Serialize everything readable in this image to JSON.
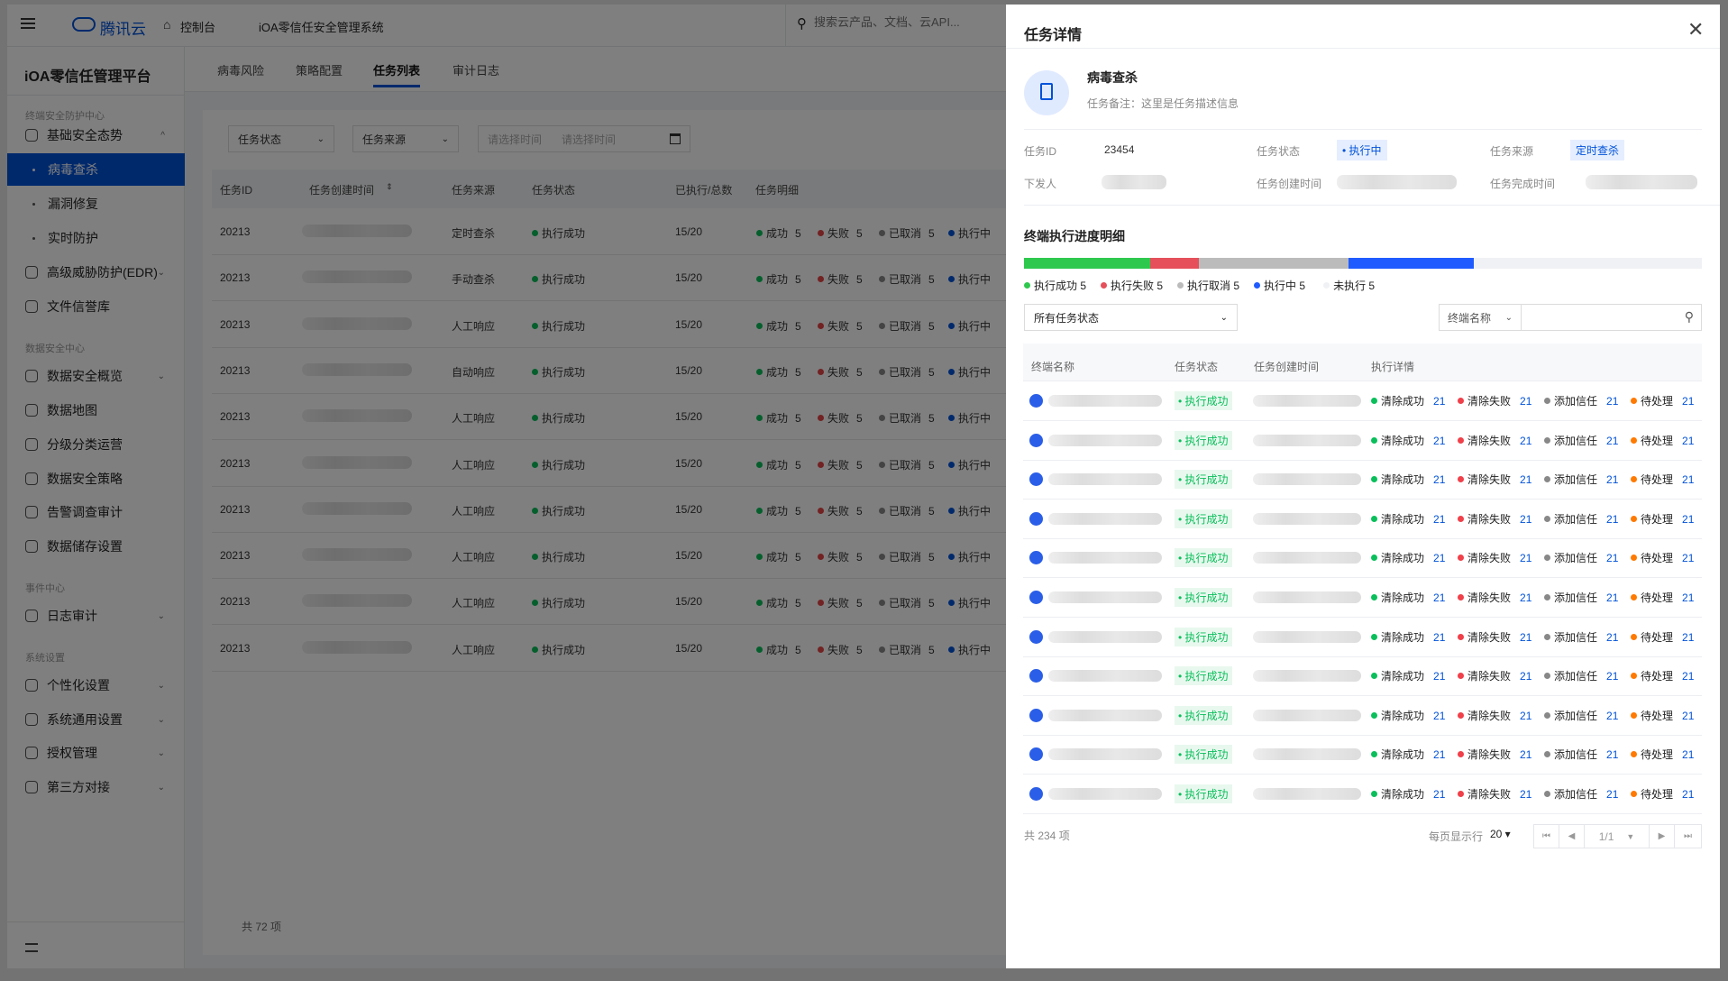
{
  "header": {
    "brand": "腾讯云",
    "console": "控制台",
    "system": "iOA零信任安全管理系统",
    "search_placeholder": "搜索云产品、文档、云API..."
  },
  "sidebar": {
    "title": "iOA零信任管理平台",
    "items": [
      {
        "type": "group",
        "label": "终端安全防护中心"
      },
      {
        "type": "item",
        "label": "基础安全态势",
        "chev": "^"
      },
      {
        "type": "sub",
        "label": "病毒查杀",
        "active": true
      },
      {
        "type": "sub",
        "label": "漏洞修复"
      },
      {
        "type": "sub",
        "label": "实时防护"
      },
      {
        "type": "item",
        "label": "高级威胁防护(EDR)",
        "chev": "⌄"
      },
      {
        "type": "item",
        "label": "文件信誉库"
      },
      {
        "type": "group",
        "label": "数据安全中心"
      },
      {
        "type": "item",
        "label": "数据安全概览",
        "chev": "⌄"
      },
      {
        "type": "item",
        "label": "数据地图"
      },
      {
        "type": "item",
        "label": "分级分类运营"
      },
      {
        "type": "item",
        "label": "数据安全策略"
      },
      {
        "type": "item",
        "label": "告警调查审计"
      },
      {
        "type": "item",
        "label": "数据储存设置"
      },
      {
        "type": "group",
        "label": "事件中心"
      },
      {
        "type": "item",
        "label": "日志审计",
        "chev": "⌄"
      },
      {
        "type": "group",
        "label": "系统设置"
      },
      {
        "type": "item",
        "label": "个性化设置",
        "chev": "⌄"
      },
      {
        "type": "item",
        "label": "系统通用设置",
        "chev": "⌄"
      },
      {
        "type": "item",
        "label": "授权管理",
        "chev": "⌄"
      },
      {
        "type": "item",
        "label": "第三方对接",
        "chev": "⌄"
      }
    ]
  },
  "tabs": [
    "病毒风险",
    "策略配置",
    "任务列表",
    "审计日志"
  ],
  "active_tab": 2,
  "filters": {
    "status": "任务状态",
    "source": "任务来源",
    "start_placeholder": "请选择时间",
    "end_placeholder": "请选择时间"
  },
  "table": {
    "headers": [
      "任务ID",
      "任务创建时间",
      "任务来源",
      "任务状态",
      "已执行/总数",
      "任务明细"
    ],
    "rows": [
      {
        "id": "20213",
        "source": "定时查杀",
        "status": "执行成功",
        "progress": "15/20"
      },
      {
        "id": "20213",
        "source": "手动查杀",
        "status": "执行成功",
        "progress": "15/20"
      },
      {
        "id": "20213",
        "source": "人工响应",
        "status": "执行成功",
        "progress": "15/20"
      },
      {
        "id": "20213",
        "source": "自动响应",
        "status": "执行成功",
        "progress": "15/20"
      },
      {
        "id": "20213",
        "source": "人工响应",
        "status": "执行成功",
        "progress": "15/20"
      },
      {
        "id": "20213",
        "source": "人工响应",
        "status": "执行成功",
        "progress": "15/20"
      },
      {
        "id": "20213",
        "source": "人工响应",
        "status": "执行成功",
        "progress": "15/20"
      },
      {
        "id": "20213",
        "source": "人工响应",
        "status": "执行成功",
        "progress": "15/20"
      },
      {
        "id": "20213",
        "source": "人工响应",
        "status": "执行成功",
        "progress": "15/20"
      },
      {
        "id": "20213",
        "source": "人工响应",
        "status": "执行成功",
        "progress": "15/20"
      }
    ],
    "detail": [
      {
        "label": "成功",
        "count": "5",
        "color": "#0abf5b"
      },
      {
        "label": "失败",
        "count": "5",
        "color": "#e54545"
      },
      {
        "label": "已取消",
        "count": "5",
        "color": "#888888"
      },
      {
        "label": "执行中",
        "count": "",
        "color": "#0052d9"
      }
    ],
    "total": "共 72 项"
  },
  "drawer": {
    "title": "任务详情",
    "task_name": "病毒查杀",
    "note": "任务备注：这里是任务描述信息",
    "info": {
      "id_label": "任务ID",
      "id": "23454",
      "status_label": "任务状态",
      "status": "• 执行中",
      "source_label": "任务来源",
      "source": "定时查杀",
      "issuer_label": "下发人",
      "created_label": "任务创建时间",
      "finished_label": "任务完成时间"
    },
    "section_title": "终端执行进度明细",
    "progress": [
      {
        "label": "执行成功 5",
        "color": "#2fc84f",
        "fraction": 0.186
      },
      {
        "label": "执行失败 5",
        "color": "#e5505a",
        "fraction": 0.072
      },
      {
        "label": "执行取消 5",
        "color": "#bbbbbb",
        "fraction": 0.221
      },
      {
        "label": "执行中 5",
        "color": "#1f5bff",
        "fraction": 0.185
      },
      {
        "label": "未执行 5",
        "color": "#f0f1f5",
        "fraction": 0.336
      }
    ],
    "status_filter": "所有任务状态",
    "name_filter": "终端名称",
    "headers": [
      "终端名称",
      "任务状态",
      "任务创建时间",
      "执行详情"
    ],
    "row_status": "• 执行成功",
    "row_count": 11,
    "detail": [
      {
        "label": "清除成功",
        "count": "21",
        "color": "#0abf5b"
      },
      {
        "label": "清除失败",
        "count": "21",
        "color": "#f0404a"
      },
      {
        "label": "添加信任",
        "count": "21",
        "color": "#888888"
      },
      {
        "label": "待处理",
        "count": "21",
        "color": "#ff7a00"
      }
    ],
    "total": "共 234 项",
    "page_size_label": "每页显示行",
    "page_size": "20 ▾",
    "page": "1/1"
  }
}
